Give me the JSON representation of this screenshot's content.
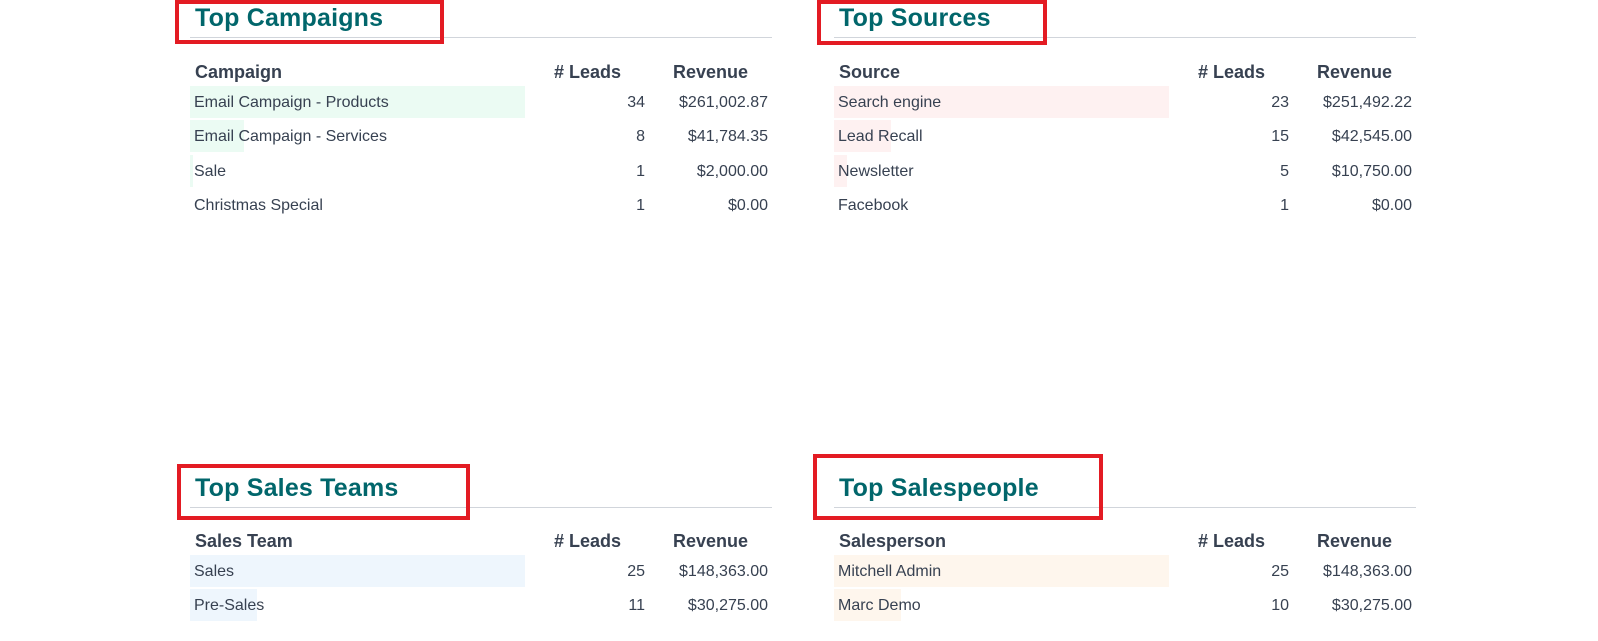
{
  "colors": {
    "title": "#01666b",
    "highlight_border": "#e31b23",
    "campaign_bar": "#ebfbf3",
    "source_bar": "#fef1f1",
    "team_bar": "#eef6fd",
    "person_bar": "#fef6ed"
  },
  "campaigns": {
    "title": "Top Campaigns",
    "columns": [
      "Campaign",
      "# Leads",
      "Revenue"
    ],
    "rows": [
      {
        "name": "Email Campaign - Products",
        "leads": "34",
        "revenue": "$261,002.87",
        "share": 1.0
      },
      {
        "name": "Email Campaign - Services",
        "leads": "8",
        "revenue": "$41,784.35",
        "share": 0.16
      },
      {
        "name": "Sale",
        "leads": "1",
        "revenue": "$2,000.00",
        "share": 0.01
      },
      {
        "name": "Christmas Special",
        "leads": "1",
        "revenue": "$0.00",
        "share": 0.0
      }
    ]
  },
  "sources": {
    "title": "Top Sources",
    "columns": [
      "Source",
      "# Leads",
      "Revenue"
    ],
    "rows": [
      {
        "name": "Search engine",
        "leads": "23",
        "revenue": "$251,492.22",
        "share": 1.0
      },
      {
        "name": "Lead Recall",
        "leads": "15",
        "revenue": "$42,545.00",
        "share": 0.17
      },
      {
        "name": "Newsletter",
        "leads": "5",
        "revenue": "$10,750.00",
        "share": 0.04
      },
      {
        "name": "Facebook",
        "leads": "1",
        "revenue": "$0.00",
        "share": 0.0
      }
    ]
  },
  "teams": {
    "title": "Top Sales Teams",
    "columns": [
      "Sales Team",
      "# Leads",
      "Revenue"
    ],
    "rows": [
      {
        "name": "Sales",
        "leads": "25",
        "revenue": "$148,363.00",
        "share": 1.0
      },
      {
        "name": "Pre-Sales",
        "leads": "11",
        "revenue": "$30,275.00",
        "share": 0.2
      }
    ]
  },
  "people": {
    "title": "Top Salespeople",
    "columns": [
      "Salesperson",
      "# Leads",
      "Revenue"
    ],
    "rows": [
      {
        "name": "Mitchell Admin",
        "leads": "25",
        "revenue": "$148,363.00",
        "share": 1.0
      },
      {
        "name": "Marc Demo",
        "leads": "10",
        "revenue": "$30,275.00",
        "share": 0.2
      }
    ]
  }
}
